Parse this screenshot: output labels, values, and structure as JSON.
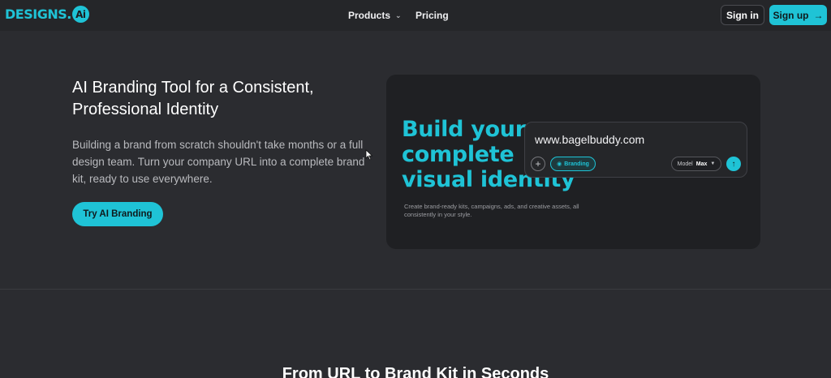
{
  "nav": {
    "logo_text": "DESIGNS.",
    "logo_badge": "Ai",
    "products_label": "Products",
    "pricing_label": "Pricing",
    "signin_label": "Sign in",
    "signup_label": "Sign up"
  },
  "hero": {
    "title": "AI Branding Tool for a Consistent, Professional Identity",
    "description": "Building a brand from scratch shouldn't take months or a full design team. Turn your company URL into a complete brand kit, ready to use everywhere.",
    "cta_label": "Try AI Branding"
  },
  "preview": {
    "headline_line1": "Build your",
    "headline_line2": "complete",
    "headline_line3": "visual identity",
    "subtext": "Create brand-ready kits, campaigns, ads, and creative assets, all consistently in your style.",
    "url_value": "www.bagelbuddy.com",
    "chip_label": "Branding",
    "model_label": "Model",
    "model_value": "Max"
  },
  "next_section": {
    "title": "From URL to Brand Kit in Seconds"
  },
  "colors": {
    "accent": "#1fc3d6",
    "background": "#2b2c30",
    "card": "#1f2023"
  },
  "icons": {
    "products_chevron": "chevron-down-icon",
    "signup_arrow": "arrow-right-icon",
    "plus": "plus-icon",
    "chip": "palette-icon",
    "send": "arrow-up-icon"
  }
}
